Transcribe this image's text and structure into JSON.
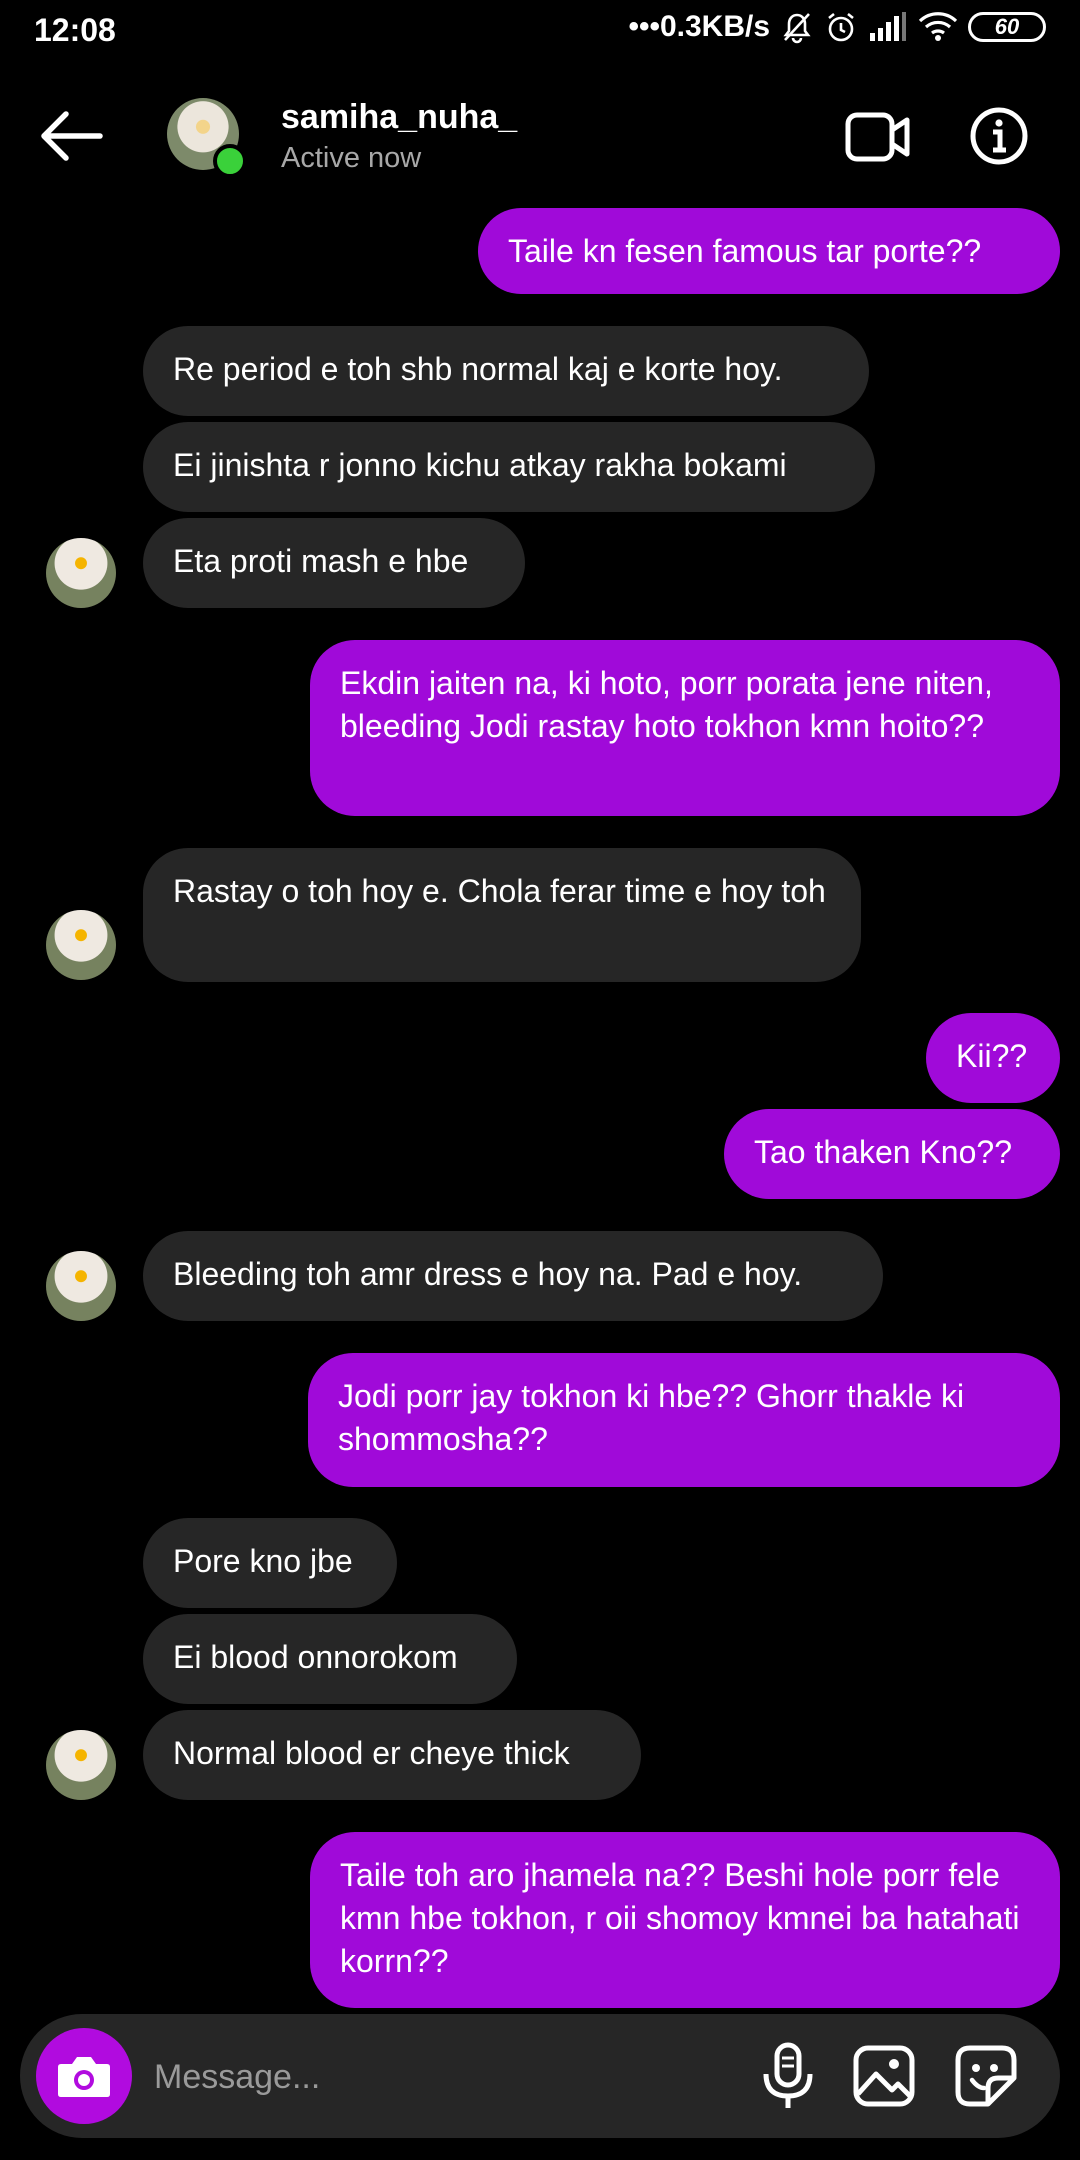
{
  "status_bar": {
    "time": "12:08",
    "net_speed": "•••0.3KB/s",
    "battery": "60"
  },
  "header": {
    "username": "samiha_nuha_",
    "status": "Active now"
  },
  "messages": [
    {
      "from": "me",
      "text": "Taile kn fesen famous tar porte??"
    },
    {
      "from": "them",
      "text": "Re period e toh shb normal kaj e korte hoy."
    },
    {
      "from": "them",
      "text": "Ei jinishta r jonno kichu atkay rakha bokami"
    },
    {
      "from": "them",
      "text": "Eta proti mash e hbe"
    },
    {
      "from": "me",
      "text": "Ekdin jaiten na, ki hoto, porr porata jene niten, bleeding Jodi rastay hoto tokhon kmn hoito??"
    },
    {
      "from": "them",
      "text": "Rastay o toh hoy e. Chola ferar time e hoy toh"
    },
    {
      "from": "me",
      "text": "Kii??"
    },
    {
      "from": "me",
      "text": "Tao thaken Kno??"
    },
    {
      "from": "them",
      "text": "Bleeding toh amr dress e hoy na. Pad e hoy."
    },
    {
      "from": "me",
      "text": "Jodi porr jay tokhon ki hbe?? Ghorr thakle ki shommosha??"
    },
    {
      "from": "them",
      "text": "Pore kno jbe"
    },
    {
      "from": "them",
      "text": "Ei blood onnorokom"
    },
    {
      "from": "them",
      "text": "Normal blood er cheye thick"
    },
    {
      "from": "me",
      "text": "Taile toh aro jhamela na?? Beshi hole porr fele kmn hbe tokhon, r oii shomoy kmnei ba hatahati korrn??"
    }
  ],
  "composer": {
    "placeholder": "Message..."
  },
  "colors": {
    "sent_bubble": "#a00ad9",
    "received_bubble": "#262626",
    "background": "#000000",
    "online": "#3ad13a"
  },
  "icons": [
    "back-arrow-icon",
    "video-call-icon",
    "info-icon",
    "camera-icon",
    "microphone-icon",
    "gallery-icon",
    "sticker-icon"
  ]
}
